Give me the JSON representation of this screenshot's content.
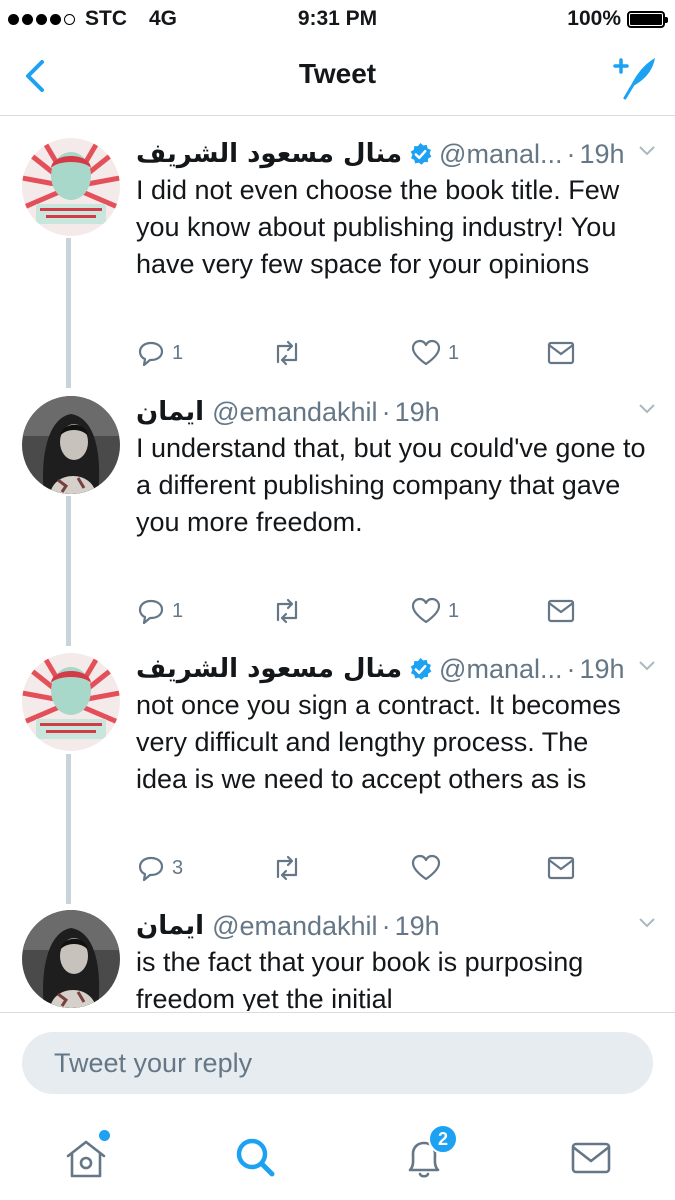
{
  "status_bar": {
    "carrier": "STC",
    "network": "4G",
    "time": "9:31 PM",
    "battery": "100%",
    "signal_bars": 4
  },
  "nav": {
    "title": "Tweet"
  },
  "tweets": [
    {
      "name": "منال مسعود الشريف",
      "verified": true,
      "handle": "@manal...",
      "time": "19h",
      "text": "I did not even choose the book title. Few you know about publishing industry! You have very few space for your opinions",
      "replies": "1",
      "retweets": "",
      "likes": "1"
    },
    {
      "name": "ايمان",
      "verified": false,
      "handle": "@emandakhil",
      "time": "19h",
      "text": "I understand that, but you could've gone to a different publishing company that gave you more freedom.",
      "replies": "1",
      "retweets": "",
      "likes": "1"
    },
    {
      "name": "منال مسعود الشريف",
      "verified": true,
      "handle": "@manal...",
      "time": "19h",
      "text": "not once you sign a contract. It becomes very difficult and lengthy process. The idea is we need to accept others as is",
      "replies": "3",
      "retweets": "",
      "likes": ""
    },
    {
      "name": "ايمان",
      "verified": false,
      "handle": "@emandakhil",
      "time": "19h",
      "text": "is the fact that your book is purposing freedom yet the initial",
      "replies": "",
      "retweets": "",
      "likes": ""
    }
  ],
  "reply": {
    "placeholder": "Tweet your reply"
  },
  "tabs": {
    "notifications_badge": "2"
  },
  "colors": {
    "accent": "#1da1f2",
    "secondary_text": "#657786",
    "line": "#c9d3da"
  }
}
